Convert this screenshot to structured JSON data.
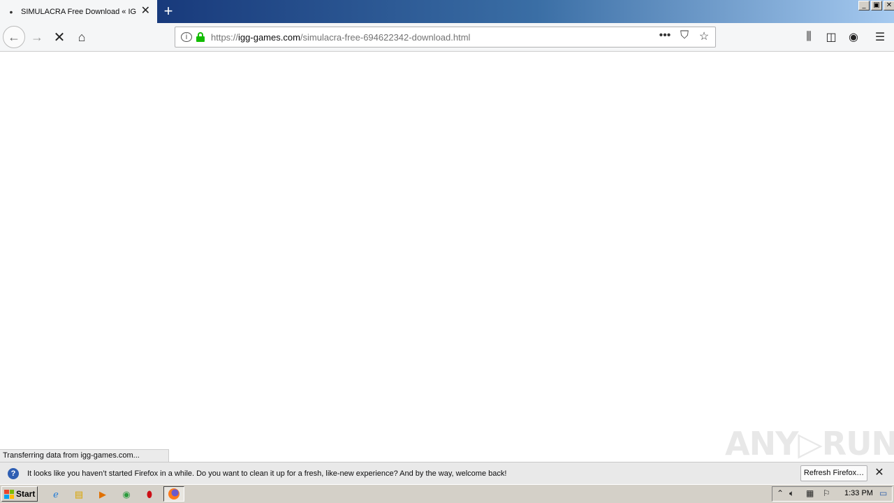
{
  "window": {
    "tab_title": "SIMULACRA Free Download « IGG",
    "tab_loading_icon": "loading-icon",
    "new_tab_label": "+",
    "controls": [
      "_",
      "▣",
      "✕"
    ]
  },
  "navbar": {
    "url_scheme": "https://",
    "url_host": "igg-games.com",
    "url_path": "/simulacra-free-694622342-download.html",
    "page_actions": [
      "•••",
      "⛉",
      "☆"
    ],
    "secure_color": "#12bc00"
  },
  "status": {
    "text": "Transferring data from igg-games.com..."
  },
  "watermark": {
    "text": "ANY▷RUN"
  },
  "notification": {
    "message": "It looks like you haven’t started Firefox in a while. Do you want to clean it up for a fresh, like-new experience? And by the way, welcome back!",
    "button_label": "Refresh Firefox…"
  },
  "taskbar": {
    "start_label": "Start",
    "clock": "1:33 PM"
  }
}
